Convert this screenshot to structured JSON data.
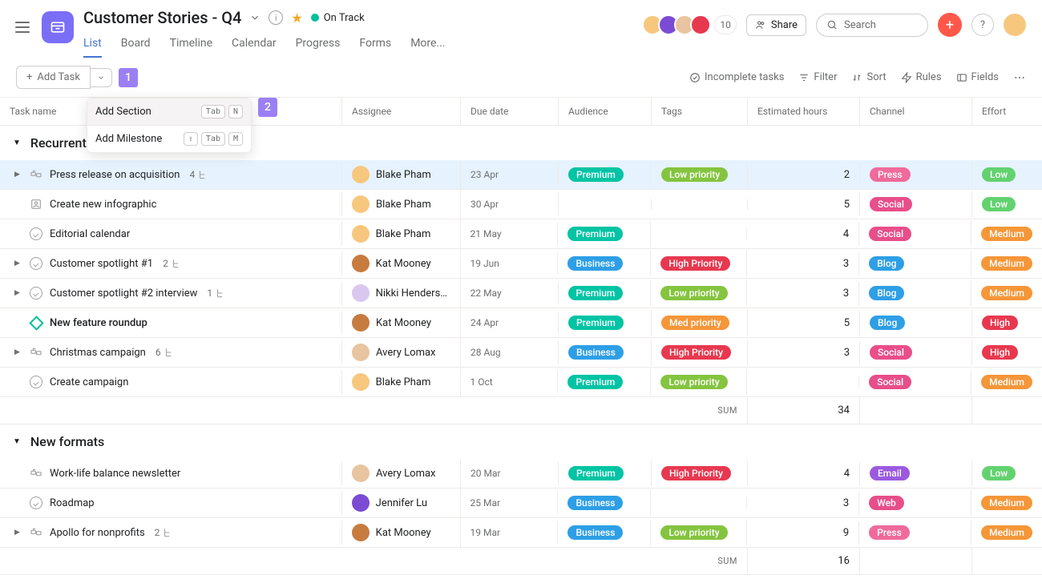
{
  "project": {
    "title": "Customer Stories - Q4",
    "status": "On Track"
  },
  "tabs": {
    "list": "List",
    "board": "Board",
    "timeline": "Timeline",
    "calendar": "Calendar",
    "progress": "Progress",
    "forms": "Forms",
    "more": "More..."
  },
  "header": {
    "avatar_count": "10",
    "share": "Share",
    "search_placeholder": "Search"
  },
  "toolbar": {
    "add_task": "Add Task",
    "badge_1": "1",
    "badge_2": "2",
    "incomplete": "Incomplete tasks",
    "filter": "Filter",
    "sort": "Sort",
    "rules": "Rules",
    "fields": "Fields",
    "menu": {
      "add_section": "Add Section",
      "kbd_tab": "Tab",
      "kbd_n": "N",
      "add_milestone": "Add Milestone",
      "kbd_shift": "⇧",
      "kbd_m": "M"
    }
  },
  "columns": {
    "task_name": "Task name",
    "assignee": "Assignee",
    "due": "Due date",
    "audience": "Audience",
    "tags": "Tags",
    "hours": "Estimated hours",
    "channel": "Channel",
    "effort": "Effort"
  },
  "sections": [
    {
      "title": "Recurrent pieces",
      "sum": "34",
      "tasks": [
        {
          "icon": "approval",
          "title": "Press release on acquisition",
          "sub": "4",
          "caret": true,
          "highlight": true,
          "assignee": "Blake Pham",
          "av": "#f8c77e",
          "due": "23 Apr",
          "aud": {
            "t": "Premium",
            "c": "#00c4a4"
          },
          "tag": {
            "t": "Low priority",
            "c": "#84c43f"
          },
          "hrs": "2",
          "ch": {
            "t": "Press",
            "c": "#f06a9b"
          },
          "ef": {
            "t": "Low",
            "c": "#62d26f"
          }
        },
        {
          "icon": "frame",
          "title": "Create new infographic",
          "caret": false,
          "assignee": "Blake Pham",
          "av": "#f8c77e",
          "due": "30 Apr",
          "hrs": "5",
          "ch": {
            "t": "Social",
            "c": "#e84e8a"
          },
          "ef": {
            "t": "Low",
            "c": "#62d26f"
          }
        },
        {
          "icon": "check",
          "title": "Editorial calendar",
          "caret": false,
          "assignee": "Blake Pham",
          "av": "#f8c77e",
          "due": "21 May",
          "aud": {
            "t": "Premium",
            "c": "#00c4a4"
          },
          "hrs": "4",
          "ch": {
            "t": "Social",
            "c": "#e84e8a"
          },
          "ef": {
            "t": "Medium",
            "c": "#f59638"
          }
        },
        {
          "icon": "check",
          "title": "Customer spotlight #1",
          "sub": "2",
          "caret": true,
          "assignee": "Kat Mooney",
          "av": "#c77b3f",
          "due": "19 Jun",
          "aud": {
            "t": "Business",
            "c": "#2e9fe6"
          },
          "tag": {
            "t": "High Priority",
            "c": "#e8384f"
          },
          "hrs": "3",
          "ch": {
            "t": "Blog",
            "c": "#2e9fe6"
          },
          "ef": {
            "t": "Medium",
            "c": "#f59638"
          }
        },
        {
          "icon": "check",
          "title": "Customer spotlight #2 interview",
          "sub": "1",
          "caret": true,
          "assignee": "Nikki Henderson ...",
          "av": "#d9c7f0",
          "due": "22 May",
          "aud": {
            "t": "Premium",
            "c": "#00c4a4"
          },
          "tag": {
            "t": "Low priority",
            "c": "#84c43f"
          },
          "hrs": "3",
          "ch": {
            "t": "Blog",
            "c": "#2e9fe6"
          },
          "ef": {
            "t": "Medium",
            "c": "#f59638"
          }
        },
        {
          "icon": "milestone",
          "title": "New feature roundup",
          "bold": true,
          "caret": false,
          "assignee": "Kat Mooney",
          "av": "#c77b3f",
          "due": "24 Apr",
          "aud": {
            "t": "Premium",
            "c": "#00c4a4"
          },
          "tag": {
            "t": "Med priority",
            "c": "#f59638"
          },
          "hrs": "5",
          "ch": {
            "t": "Blog",
            "c": "#2e9fe6"
          },
          "ef": {
            "t": "High",
            "c": "#e8384f"
          }
        },
        {
          "icon": "approval",
          "title": "Christmas campaign",
          "sub": "6",
          "caret": true,
          "assignee": "Avery Lomax",
          "av": "#e8c4a0",
          "due": "28 Aug",
          "aud": {
            "t": "Business",
            "c": "#2e9fe6"
          },
          "tag": {
            "t": "High Priority",
            "c": "#e8384f"
          },
          "hrs": "3",
          "ch": {
            "t": "Social",
            "c": "#e84e8a"
          },
          "ef": {
            "t": "High",
            "c": "#e8384f"
          }
        },
        {
          "icon": "check",
          "title": "Create campaign",
          "caret": false,
          "assignee": "Blake Pham",
          "av": "#f8c77e",
          "due": "1 Oct",
          "aud": {
            "t": "Premium",
            "c": "#00c4a4"
          },
          "tag": {
            "t": "Low priority",
            "c": "#84c43f"
          },
          "hrs": "",
          "ch": {
            "t": "Social",
            "c": "#e84e8a"
          },
          "ef": {
            "t": "Medium",
            "c": "#f59638"
          }
        }
      ]
    },
    {
      "title": "New formats",
      "sum": "16",
      "tasks": [
        {
          "icon": "approval",
          "title": "Work-life balance newsletter",
          "caret": false,
          "assignee": "Avery Lomax",
          "av": "#e8c4a0",
          "due": "20 Mar",
          "aud": {
            "t": "Premium",
            "c": "#00c4a4"
          },
          "tag": {
            "t": "High Priority",
            "c": "#e8384f"
          },
          "hrs": "4",
          "ch": {
            "t": "Email",
            "c": "#9b59e0"
          },
          "ef": {
            "t": "Low",
            "c": "#62d26f"
          }
        },
        {
          "icon": "check",
          "title": "Roadmap",
          "caret": false,
          "assignee": "Jennifer Lu",
          "av": "#7b4bd4",
          "due": "25 Mar",
          "aud": {
            "t": "Business",
            "c": "#2e9fe6"
          },
          "hrs": "3",
          "ch": {
            "t": "Web",
            "c": "#e84e8a"
          },
          "ef": {
            "t": "Medium",
            "c": "#f59638"
          }
        },
        {
          "icon": "approval",
          "title": "Apollo for nonprofits",
          "sub": "2",
          "caret": true,
          "assignee": "Kat Mooney",
          "av": "#c77b3f",
          "due": "19 Mar",
          "aud": {
            "t": "Business",
            "c": "#2e9fe6"
          },
          "tag": {
            "t": "Low priority",
            "c": "#84c43f"
          },
          "hrs": "9",
          "ch": {
            "t": "Press",
            "c": "#f06a9b"
          },
          "ef": {
            "t": "Medium",
            "c": "#f59638"
          }
        }
      ]
    }
  ],
  "sum_label": "SUM"
}
